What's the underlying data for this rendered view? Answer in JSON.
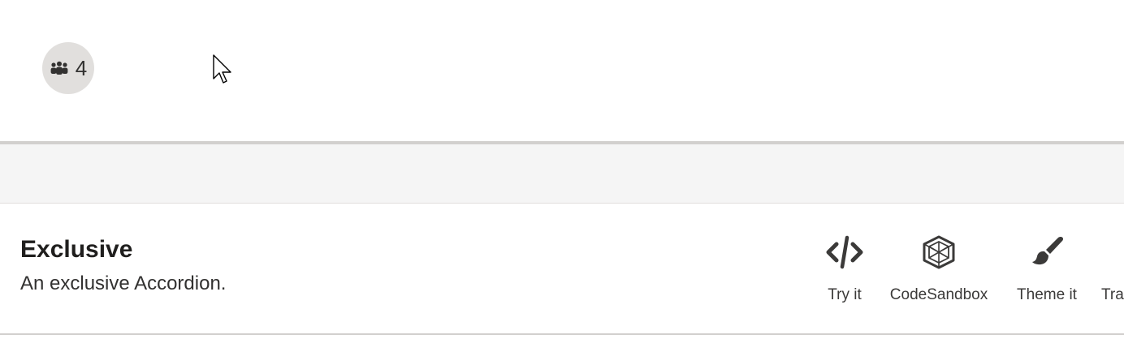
{
  "people_badge": {
    "icon": "people-team-icon",
    "count": "4"
  },
  "example": {
    "title": "Exclusive",
    "description": "An exclusive Accordion."
  },
  "actions": [
    {
      "label": "Try it",
      "icon": "code-icon"
    },
    {
      "label": "CodeSandbox",
      "icon": "codesandbox-icon"
    },
    {
      "label": "Theme it",
      "icon": "paintbrush-icon"
    },
    {
      "label": "Tra",
      "icon": ""
    }
  ],
  "colors": {
    "chip_bg": "#e1dfdd",
    "band_bg": "#f5f5f5",
    "text_primary": "#201f1e",
    "text_secondary": "#323130"
  }
}
